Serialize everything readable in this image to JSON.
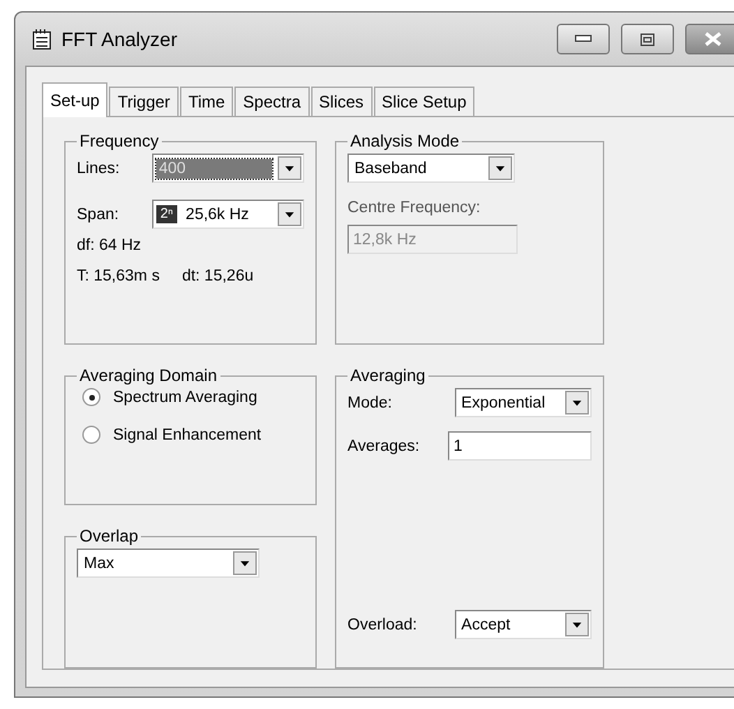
{
  "window": {
    "title": "FFT Analyzer"
  },
  "tabs": [
    {
      "label": "Set-up",
      "selected": true
    },
    {
      "label": "Trigger",
      "selected": false
    },
    {
      "label": "Time",
      "selected": false
    },
    {
      "label": "Spectra",
      "selected": false
    },
    {
      "label": "Slices",
      "selected": false
    },
    {
      "label": "Slice Setup",
      "selected": false
    }
  ],
  "frequency": {
    "title": "Frequency",
    "lines": {
      "label": "Lines:",
      "value": "400",
      "focused": true
    },
    "span": {
      "label": "Span:",
      "badge": "2ⁿ",
      "value": "25,6k Hz"
    },
    "df": "df: 64 Hz",
    "t": "T: 15,63m s",
    "dt": "dt: 15,26u"
  },
  "analysis_mode": {
    "title": "Analysis Mode",
    "value": "Baseband",
    "centre_label": "Centre Frequency:",
    "centre_value": "12,8k Hz",
    "centre_disabled": true
  },
  "averaging_domain": {
    "title": "Averaging Domain",
    "options": [
      {
        "label": "Spectrum Averaging",
        "selected": true
      },
      {
        "label": "Signal Enhancement",
        "selected": false
      }
    ]
  },
  "overlap": {
    "title": "Overlap",
    "value": "Max"
  },
  "averaging": {
    "title": "Averaging",
    "mode": {
      "label": "Mode:",
      "value": "Exponential"
    },
    "averages": {
      "label": "Averages:",
      "value": "1"
    },
    "overload": {
      "label": "Overload:",
      "value": "Accept"
    }
  }
}
